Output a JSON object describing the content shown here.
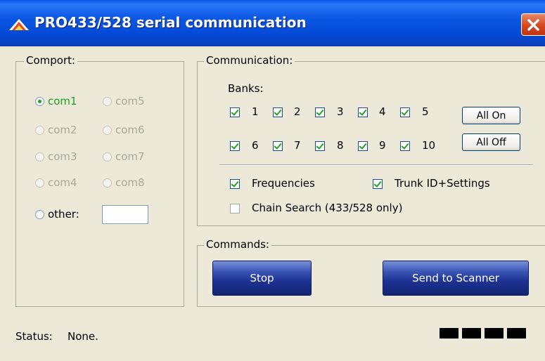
{
  "window": {
    "title": "PRO433/528 serial communication"
  },
  "comport": {
    "legend": "Comport:",
    "options": [
      {
        "label": "com1",
        "selected": true,
        "enabled": true
      },
      {
        "label": "com2",
        "selected": false,
        "enabled": false
      },
      {
        "label": "com3",
        "selected": false,
        "enabled": false
      },
      {
        "label": "com4",
        "selected": false,
        "enabled": false
      },
      {
        "label": "com5",
        "selected": false,
        "enabled": false
      },
      {
        "label": "com6",
        "selected": false,
        "enabled": false
      },
      {
        "label": "com7",
        "selected": false,
        "enabled": false
      },
      {
        "label": "com8",
        "selected": false,
        "enabled": false
      }
    ],
    "other": {
      "label": "other:",
      "value": ""
    }
  },
  "communication": {
    "legend": "Communication:",
    "banks_label": "Banks:",
    "banks": [
      {
        "label": "1",
        "checked": true
      },
      {
        "label": "2",
        "checked": true
      },
      {
        "label": "3",
        "checked": true
      },
      {
        "label": "4",
        "checked": true
      },
      {
        "label": "5",
        "checked": true
      },
      {
        "label": "6",
        "checked": true
      },
      {
        "label": "7",
        "checked": true
      },
      {
        "label": "8",
        "checked": true
      },
      {
        "label": "9",
        "checked": true
      },
      {
        "label": "10",
        "checked": true
      }
    ],
    "all_on": "All On",
    "all_off": "All Off",
    "frequencies": {
      "label": "Frequencies",
      "checked": true
    },
    "trunk": {
      "label": "Trunk ID+Settings",
      "checked": true
    },
    "chain": {
      "label": "Chain Search (433/528 only)",
      "checked": false
    }
  },
  "commands": {
    "legend": "Commands:",
    "stop": "Stop",
    "send": "Send to Scanner"
  },
  "status": {
    "label": "Status:",
    "value": "None.",
    "indicator_blocks": 4
  }
}
